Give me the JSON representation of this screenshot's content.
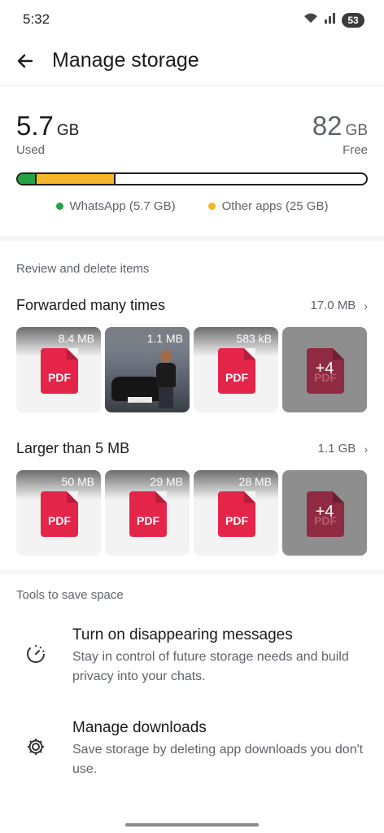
{
  "status_bar": {
    "time": "5:32",
    "battery": "53"
  },
  "header": {
    "title": "Manage storage"
  },
  "usage": {
    "used_value": "5.7",
    "used_unit": "GB",
    "used_label": "Used",
    "free_value": "82",
    "free_unit": "GB",
    "free_label": "Free",
    "whatsapp_fraction": 0.05,
    "other_fraction": 0.22,
    "whatsapp_color": "#25a244",
    "other_color": "#f5b62b",
    "legend_whatsapp": "WhatsApp (5.7 GB)",
    "legend_other": "Other apps (25 GB)"
  },
  "review": {
    "label": "Review and delete items",
    "forwarded": {
      "title": "Forwarded many times",
      "size": "17.0 MB",
      "items": [
        {
          "type": "pdf",
          "size": "8.4 MB",
          "icon_text": "PDF"
        },
        {
          "type": "photo",
          "size": "1.1 MB"
        },
        {
          "type": "pdf",
          "size": "583 kB",
          "icon_text": "PDF"
        },
        {
          "type": "more",
          "count": "+4",
          "icon_text": "PDF"
        }
      ]
    },
    "larger": {
      "title": "Larger than 5 MB",
      "size": "1.1 GB",
      "items": [
        {
          "type": "pdf",
          "size": "50 MB",
          "icon_text": "PDF"
        },
        {
          "type": "pdf",
          "size": "29 MB",
          "icon_text": "PDF"
        },
        {
          "type": "pdf",
          "size": "28 MB",
          "icon_text": "PDF"
        },
        {
          "type": "more",
          "count": "+4",
          "icon_text": "PDF"
        }
      ]
    }
  },
  "tools": {
    "label": "Tools to save space",
    "disappearing": {
      "title": "Turn on disappearing messages",
      "desc": "Stay in control of future storage needs and build privacy into your chats."
    },
    "downloads": {
      "title": "Manage downloads",
      "desc": "Save storage by deleting app downloads you don't use."
    }
  }
}
